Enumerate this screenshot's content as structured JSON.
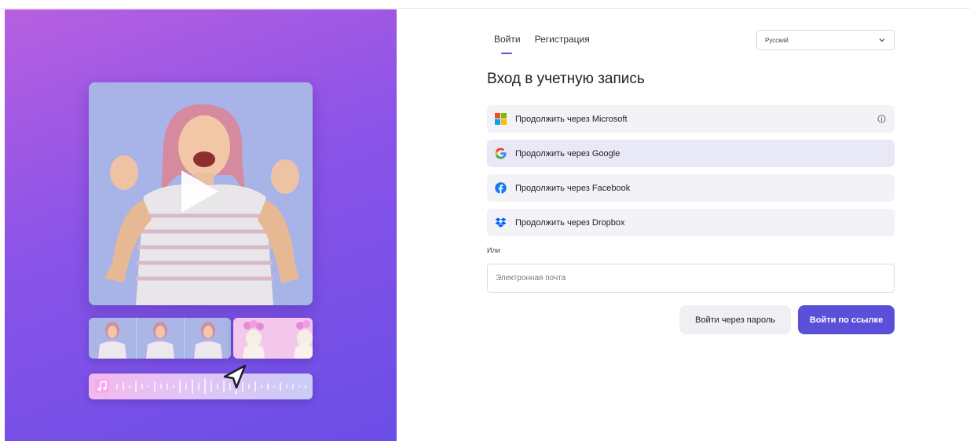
{
  "tabs": [
    {
      "label": "Войти",
      "active": true
    },
    {
      "label": "Регистрация",
      "active": false
    }
  ],
  "language": {
    "selected": "Русский"
  },
  "title": "Вход в учетную запись",
  "providers": [
    {
      "label": "Продолжить через Microsoft",
      "icon": "microsoft-icon"
    },
    {
      "label": "Продолжить через Google",
      "icon": "google-icon"
    },
    {
      "label": "Продолжить через Facebook",
      "icon": "facebook-icon"
    },
    {
      "label": "Продолжить через Dropbox",
      "icon": "dropbox-icon"
    }
  ],
  "or_label": "Или",
  "email": {
    "placeholder": "Электронная почта",
    "value": ""
  },
  "buttons": {
    "password_login": "Войти через пароль",
    "link_login": "Войти по ссылке"
  },
  "colors": {
    "accent": "#5a4fd8",
    "promo_gradient_start": "#b75fe0",
    "promo_gradient_end": "#6a4ee6"
  }
}
